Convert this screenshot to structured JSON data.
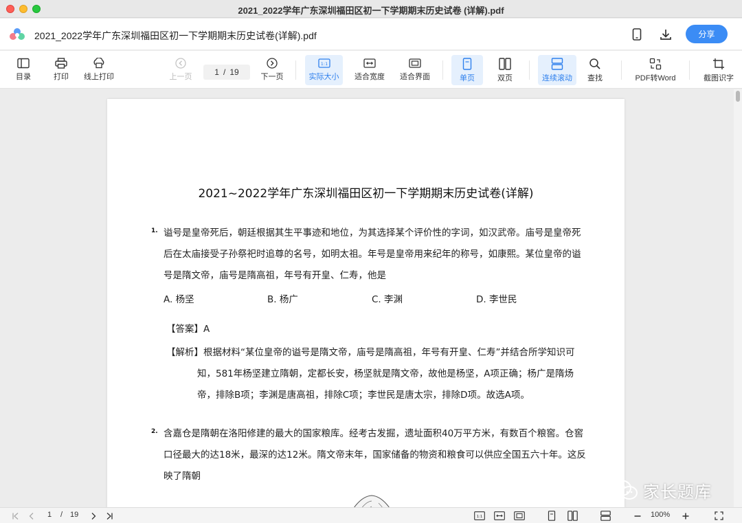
{
  "window": {
    "title": "2021_2022学年广东深圳福田区初一下学期期末历史试卷 (详解).pdf"
  },
  "appbar": {
    "doc_name": "2021_2022学年广东深圳福田区初一下学期期末历史试卷(详解).pdf",
    "share_label": "分享"
  },
  "toolbar": {
    "toc": "目录",
    "print": "打印",
    "online_print": "线上打印",
    "prev_page": "上一页",
    "current_page": "1",
    "page_sep": "/",
    "total_pages": "19",
    "next_page": "下一页",
    "actual_size": "实际大小",
    "fit_width": "适合宽度",
    "fit_window": "适合界面",
    "single_page": "单页",
    "double_page": "双页",
    "continuous_scroll": "连续滚动",
    "find": "查找",
    "pdf_to_word": "PDF转Word",
    "screenshot_ocr": "截图识字"
  },
  "document": {
    "title": "2021~2022学年广东深圳福田区初一下学期期末历史试卷(详解)",
    "q1": {
      "number": "1.",
      "line1": "谥号是皇帝死后，朝廷根据其生平事迹和地位，为其选择某个评价性的字词，如汉武帝。庙号是皇帝死",
      "line2": "后在太庙接受子孙祭祀时追尊的名号，如明太祖。年号是皇帝用来纪年的称号，如康熙。某位皇帝的谥",
      "line3": "号是隋文帝，庙号是隋高祖，年号有开皇、仁寿，他是",
      "options": [
        "A. 杨坚",
        "B. 杨广",
        "C. 李渊",
        "D. 李世民"
      ],
      "answer": "【答案】A",
      "analysis1": "【解析】根据材料“某位皇帝的谥号是隋文帝，庙号是隋高祖，年号有开皇、仁寿”并结合所学知识可",
      "analysis2": "知，581年杨坚建立隋朝，定都长安，杨坚就是隋文帝，故他是杨坚，A项正确；杨广是隋炀",
      "analysis3": "帝，排除B项；李渊是唐高祖，排除C项；李世民是唐太宗，排除D项。故选A项。"
    },
    "q2": {
      "number": "2.",
      "line1": "含嘉仓是隋朝在洛阳修建的最大的国家粮库。经考古发掘，遗址面积40万平方米，有数百个粮窖。仓窖",
      "line2": "口径最大的达18米，最深的达12米。隋文帝末年，国家储备的物资和粮食可以供应全国五六十年。这反",
      "line3": "映了隋朝"
    }
  },
  "watermark": {
    "text": "家长题库"
  },
  "statusbar": {
    "current_page": "1",
    "page_sep": "/",
    "total_pages": "19",
    "zoom": "100%"
  },
  "colors": {
    "accent": "#3b8cf5",
    "active_bg": "#e5f0fd",
    "active_text": "#2f80ed"
  }
}
